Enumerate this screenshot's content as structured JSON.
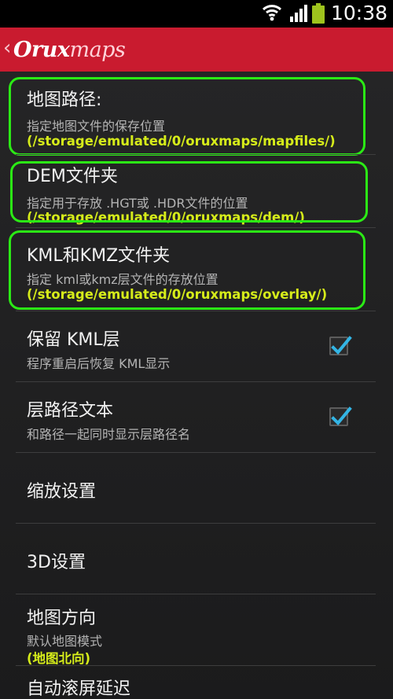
{
  "status_bar": {
    "time": "10:38",
    "icons": [
      "wifi-icon",
      "signal-icon",
      "battery-icon"
    ],
    "battery_color": "#9ec31d"
  },
  "action_bar": {
    "back_glyph": "‹",
    "logo_part1": "Orux",
    "logo_part2": "maps",
    "color": "#c91b2f"
  },
  "prefs": {
    "map_path": {
      "title": "地图路径:",
      "summary": "指定地图文件的保存位置",
      "value": "(/storage/emulated/0/oruxmaps/mapfiles/)"
    },
    "dem_folder": {
      "title": "DEM文件夹",
      "summary": "指定用于存放 .HGT或 .HDR文件的位置",
      "value": "(/storage/emulated/0/oruxmaps/dem/)"
    },
    "kml_folder": {
      "title": "KML和KMZ文件夹",
      "summary": "指定 kml或kmz层文件的存放位置",
      "value": "(/storage/emulated/0/oruxmaps/overlay/)"
    },
    "keep_kml": {
      "title": "保留 KML层",
      "summary": "程序重启后恢复 KML显示",
      "checked": true
    },
    "track_text": {
      "title": "层路径文本",
      "summary": "和路径一起同时显示层路径名",
      "checked": true
    },
    "zoom_settings": {
      "title": "缩放设置"
    },
    "settings_3d": {
      "title": "3D设置"
    },
    "map_orientation": {
      "title": "地图方向",
      "summary": "默认地图模式",
      "value": "(地图北向)"
    },
    "auto_scroll": {
      "title": "自动滚屏延迟"
    }
  },
  "colors": {
    "highlight": "#2bea15",
    "value_text": "#d6ec1a",
    "checkmark": "#33b5e5"
  }
}
